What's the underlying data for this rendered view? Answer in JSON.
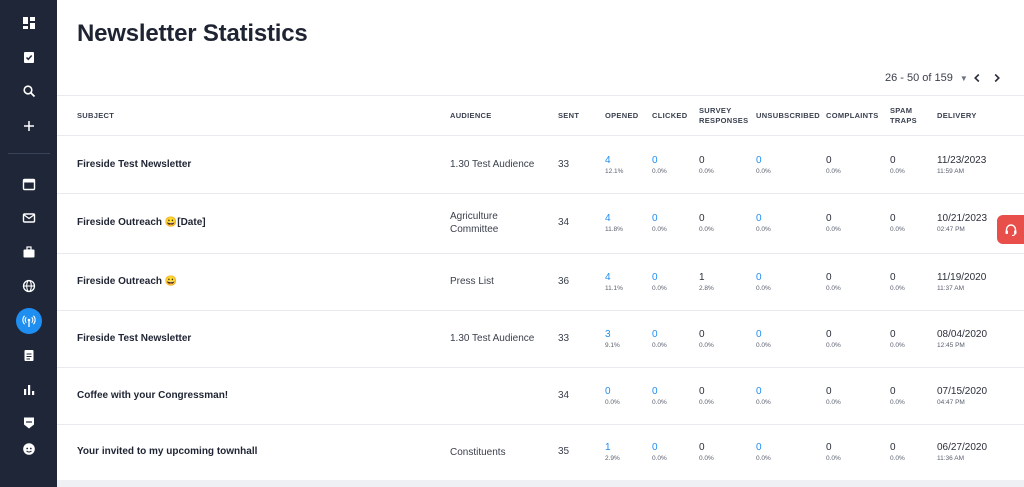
{
  "page": {
    "title": "Newsletter Statistics"
  },
  "sidebar": {
    "items": [
      {
        "icon": "dashboard-icon"
      },
      {
        "icon": "clipboard-check-icon"
      },
      {
        "icon": "search-icon"
      },
      {
        "icon": "plus-icon"
      },
      {
        "icon": "calendar-icon"
      },
      {
        "icon": "mail-icon"
      },
      {
        "icon": "briefcase-icon"
      },
      {
        "icon": "globe-icon"
      },
      {
        "icon": "broadcast-icon",
        "active": true
      },
      {
        "icon": "clipboard-list-icon"
      },
      {
        "icon": "bar-chart-icon"
      },
      {
        "icon": "badge-icon"
      },
      {
        "icon": "user-avatar-icon"
      }
    ],
    "accent": "#1f8ef1",
    "background": "#1e2638"
  },
  "pagination": {
    "range": "26 - 50 of 159"
  },
  "columns": {
    "subject": "SUBJECT",
    "audience": "AUDIENCE",
    "sent": "SENT",
    "opened": "OPENED",
    "clicked": "CLICKED",
    "survey1": "SURVEY",
    "survey2": "RESPONSES",
    "unsubscribed": "UNSUBSCRIBED",
    "complaints": "COMPLAINTS",
    "spam1": "SPAM",
    "spam2": "TRAPS",
    "delivery": "DELIVERY"
  },
  "rows": [
    {
      "subject": "Fireside Test Newsletter",
      "audience": [
        "1.30 Test Audience"
      ],
      "sent": "33",
      "opened": "4",
      "opened_pct": "12.1%",
      "clicked": "0",
      "clicked_pct": "0.0%",
      "survey": "0",
      "survey_pct": "0.0%",
      "unsubscribed": "0",
      "unsubscribed_pct": "0.0%",
      "complaints": "0",
      "complaints_pct": "0.0%",
      "spam": "0",
      "spam_pct": "0.0%",
      "delivery_date": "11/23/2023",
      "delivery_time": "11:59 AM"
    },
    {
      "subject": "Fireside Outreach 😀[Date]",
      "audience": [
        "Agriculture",
        "Committee"
      ],
      "sent": "34",
      "opened": "4",
      "opened_pct": "11.8%",
      "clicked": "0",
      "clicked_pct": "0.0%",
      "survey": "0",
      "survey_pct": "0.0%",
      "unsubscribed": "0",
      "unsubscribed_pct": "0.0%",
      "complaints": "0",
      "complaints_pct": "0.0%",
      "spam": "0",
      "spam_pct": "0.0%",
      "delivery_date": "10/21/2023",
      "delivery_time": "02:47 PM"
    },
    {
      "subject": "Fireside Outreach 😀",
      "audience": [
        "Press List"
      ],
      "sent": "36",
      "opened": "4",
      "opened_pct": "11.1%",
      "clicked": "0",
      "clicked_pct": "0.0%",
      "survey": "1",
      "survey_pct": "2.8%",
      "unsubscribed": "0",
      "unsubscribed_pct": "0.0%",
      "complaints": "0",
      "complaints_pct": "0.0%",
      "spam": "0",
      "spam_pct": "0.0%",
      "delivery_date": "11/19/2020",
      "delivery_time": "11:37 AM"
    },
    {
      "subject": "Fireside Test Newsletter",
      "audience": [
        "1.30 Test Audience"
      ],
      "sent": "33",
      "opened": "3",
      "opened_pct": "9.1%",
      "clicked": "0",
      "clicked_pct": "0.0%",
      "survey": "0",
      "survey_pct": "0.0%",
      "unsubscribed": "0",
      "unsubscribed_pct": "0.0%",
      "complaints": "0",
      "complaints_pct": "0.0%",
      "spam": "0",
      "spam_pct": "0.0%",
      "delivery_date": "08/04/2020",
      "delivery_time": "12:45 PM"
    },
    {
      "subject": "Coffee with your Congressman!",
      "audience": [],
      "sent": "34",
      "opened": "0",
      "opened_pct": "0.0%",
      "clicked": "0",
      "clicked_pct": "0.0%",
      "survey": "0",
      "survey_pct": "0.0%",
      "unsubscribed": "0",
      "unsubscribed_pct": "0.0%",
      "complaints": "0",
      "complaints_pct": "0.0%",
      "spam": "0",
      "spam_pct": "0.0%",
      "delivery_date": "07/15/2020",
      "delivery_time": "04:47 PM"
    },
    {
      "subject": "Your invited to my upcoming townhall",
      "audience": [
        "Constituents"
      ],
      "sent": "35",
      "opened": "1",
      "opened_pct": "2.9%",
      "clicked": "0",
      "clicked_pct": "0.0%",
      "survey": "0",
      "survey_pct": "0.0%",
      "unsubscribed": "0",
      "unsubscribed_pct": "0.0%",
      "complaints": "0",
      "complaints_pct": "0.0%",
      "spam": "0",
      "spam_pct": "0.0%",
      "delivery_date": "06/27/2020",
      "delivery_time": "11:36 AM"
    }
  ],
  "colors": {
    "link": "#1f8ef1",
    "help": "#e84e4a"
  }
}
